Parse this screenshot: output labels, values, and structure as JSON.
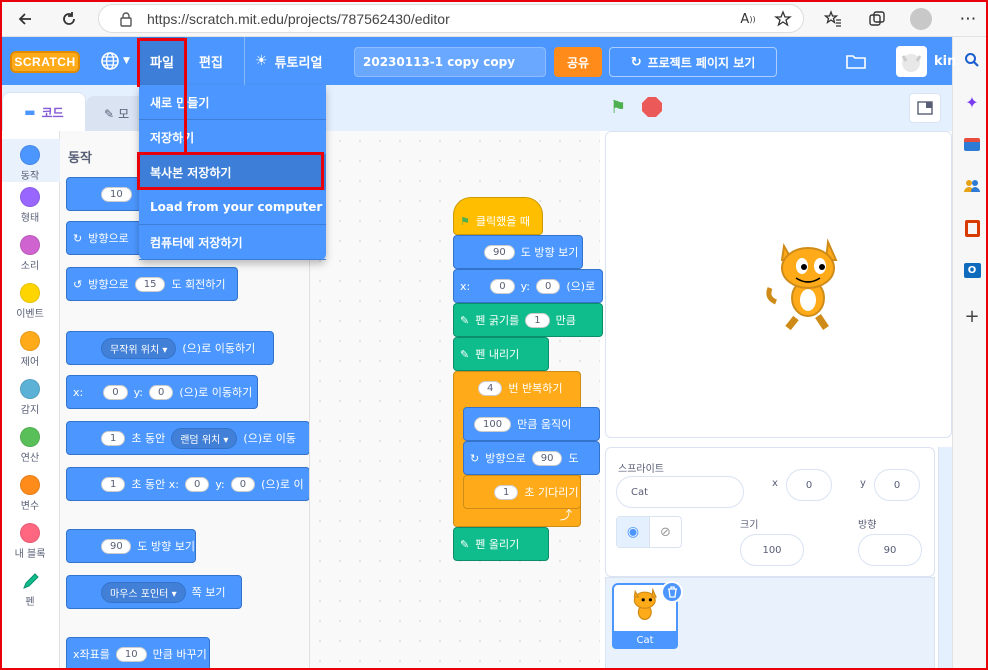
{
  "browser": {
    "url": "https://scratch.mit.edu/projects/787562430/editor",
    "back_icon": "arrow-left-icon",
    "reload_icon": "reload-icon"
  },
  "menubar": {
    "logo": "SCRATCH",
    "file": "파일",
    "edit": "편집",
    "tutorials": "튜토리얼",
    "project_title": "20230113-1 copy copy",
    "share": "공유",
    "project_page": "프로젝트 페이지 보기",
    "username": "kin"
  },
  "file_menu": {
    "items": [
      "새로 만들기",
      "저장하기",
      "복사본 저장하기",
      "Load from your computer",
      "컴퓨터에 저장하기"
    ]
  },
  "tabs": {
    "code": "코드",
    "costume": "모"
  },
  "categories": [
    {
      "label": "동작",
      "color": "#4c97ff"
    },
    {
      "label": "형태",
      "color": "#9966ff"
    },
    {
      "label": "소리",
      "color": "#cf63cf"
    },
    {
      "label": "이벤트",
      "color": "#ffd500"
    },
    {
      "label": "제어",
      "color": "#ffab19"
    },
    {
      "label": "감지",
      "color": "#5cb1d6"
    },
    {
      "label": "연산",
      "color": "#59c059"
    },
    {
      "label": "변수",
      "color": "#ff8c1a"
    },
    {
      "label": "내 블록",
      "color": "#ff6680"
    },
    {
      "label": "펜",
      "color": "#0fbd8c"
    }
  ],
  "palette": {
    "title": "동작",
    "move_val": "10",
    "turn_right": "방향으로",
    "turn_left": "방향으로",
    "turn_left_val": "15",
    "turn_left_suffix": "도 회전하기",
    "goto_random": "무작위 위치",
    "goto_suffix": "(으)로 이동하기",
    "goto_x_label": "x:",
    "goto_x": "0",
    "goto_y_label": "y:",
    "goto_y": "0",
    "goto_xy_suffix": "(으)로 이동하기",
    "glide_secs": "1",
    "glide_label": "초 동안",
    "glide_target": "랜덤 위치",
    "glide_suffix": "(으)로 이동",
    "glide2_secs": "1",
    "glide2_label": "초 동안 x:",
    "glide2_x": "0",
    "glide2_y_label": "y:",
    "glide2_y": "0",
    "glide2_suffix": "(으)로 이",
    "point_val": "90",
    "point_suffix": "도 방향 보기",
    "point_towards": "마우스 포인터",
    "point_towards_suffix": "쪽 보기",
    "change_x_prefix": "x좌표를",
    "change_x_val": "10",
    "change_x_suffix": "만큼 바꾸기"
  },
  "script": {
    "hat": "클릭했을 때",
    "point_val": "90",
    "point_suffix": "도 방향 보기",
    "goto_x_label": "x:",
    "goto_x": "0",
    "goto_y_label": "y:",
    "goto_y": "0",
    "goto_suffix": "(으)로",
    "pen_size_prefix": "펜 굵기를",
    "pen_size_val": "1",
    "pen_size_suffix": "만큼",
    "pen_down": "펜 내리기",
    "repeat_val": "4",
    "repeat_suffix": "번 반복하기",
    "move_val": "100",
    "move_suffix": "만큼 움직이",
    "turn_prefix": "방향으로",
    "turn_val": "90",
    "turn_suffix": "도",
    "wait_val": "1",
    "wait_suffix": "초 기다리기",
    "pen_up": "펜 올리기"
  },
  "sprite_info": {
    "sprite_label": "스프라이트",
    "sprite_name": "Cat",
    "x_label": "x",
    "x_val": "0",
    "y_label": "y",
    "y_val": "0",
    "size_label": "크기",
    "size_val": "100",
    "direction_label": "방향",
    "direction_val": "90",
    "thumb_label": "Cat"
  },
  "colors": {
    "scratch_blue": "#4c97ff",
    "control_orange": "#ffab19",
    "pen_green": "#0fbd8c",
    "event_yellow": "#ffbf00",
    "highlight_red": "#e8000b"
  }
}
